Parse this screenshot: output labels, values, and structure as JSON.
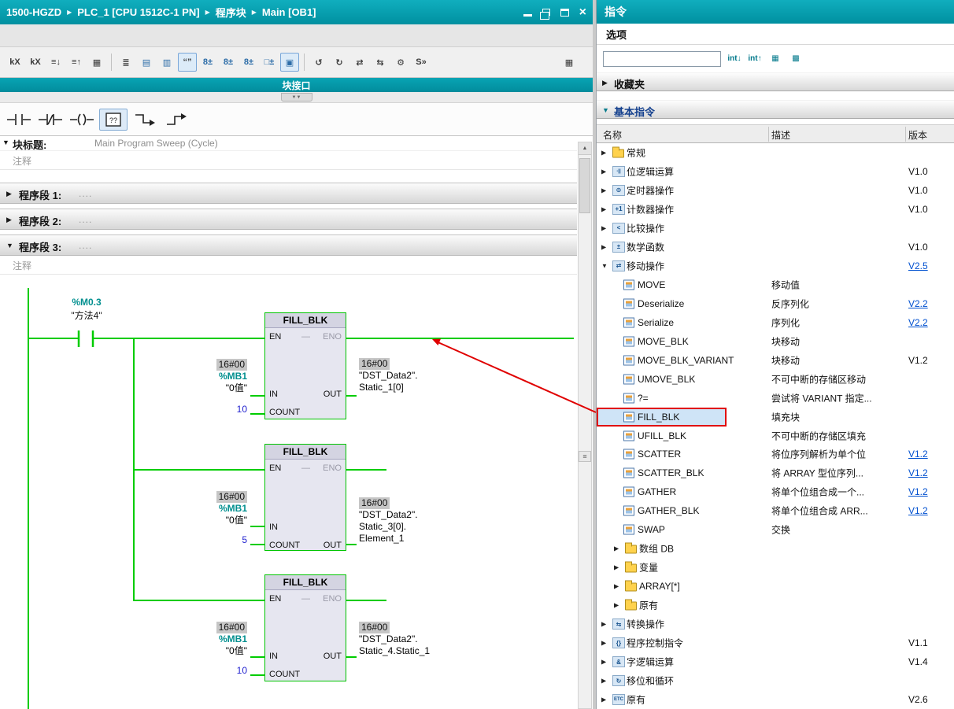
{
  "colors": {
    "titlebar_teal": "#0098a6",
    "wire_green": "#00cc00",
    "operand_teal": "#008f8f",
    "number_blue": "#2323cf",
    "link_blue": "#0050d0",
    "annotation_red": "#e00000",
    "selected_row_blue": "#cfe4f7",
    "monitor_value_bg": "#c6c6c6"
  },
  "titlebar": {
    "breadcrumb": [
      "1500-HGZD",
      "PLC_1 [CPU 1512C-1 PN]",
      "程序块",
      "Main [OB1]"
    ],
    "controls": [
      "minimize",
      "float",
      "maximize",
      "close"
    ]
  },
  "toolbar": {
    "icons": [
      {
        "name": "absolute-operands-icon",
        "glyph": "kX"
      },
      {
        "name": "symbolic-operands-icon",
        "glyph": "kX"
      },
      {
        "name": "network-expand-all-icon",
        "glyph": "≡↓"
      },
      {
        "name": "network-collapse-all-icon",
        "glyph": "≡↑"
      },
      {
        "name": "insert-network-icon",
        "glyph": "▦"
      },
      {
        "sep": true
      },
      {
        "name": "network-overview-icon",
        "glyph": "≣"
      },
      {
        "name": "maximize-editor-icon",
        "glyph": "▤",
        "blue": true
      },
      {
        "name": "split-editor-icon",
        "glyph": "▥",
        "blue": true
      },
      {
        "name": "toggle-comments-icon",
        "glyph": "“”",
        "active": true
      },
      {
        "name": "operand-absolute-info-icon",
        "glyph": "8±",
        "blue": true
      },
      {
        "name": "operand-symbolic-info-icon",
        "glyph": "8±",
        "blue": true
      },
      {
        "name": "operand-both-info-icon",
        "glyph": "8±",
        "blue": true
      },
      {
        "name": "box-parameters-icon",
        "glyph": "□±",
        "blue": true
      },
      {
        "name": "highlight-operand-icon",
        "glyph": "▣",
        "active": true,
        "blue": true
      },
      {
        "sep": true
      },
      {
        "name": "goto-previous-error-icon",
        "glyph": "↺"
      },
      {
        "name": "goto-next-error-icon",
        "glyph": "↻"
      },
      {
        "name": "update-block-calls-icon",
        "glyph": "⇄"
      },
      {
        "name": "consistency-check-icon",
        "glyph": "⇆"
      },
      {
        "name": "settings-icon",
        "glyph": "⚙"
      },
      {
        "name": "snapshot-icon",
        "glyph": "S»"
      },
      {
        "name": "editor-layout-icon",
        "glyph": "▦",
        "pushright": true
      }
    ]
  },
  "block_interface_label": "块接口",
  "editor": {
    "block_title_label": "块标题:",
    "block_title_text": "Main Program Sweep (Cycle)",
    "comment_text": "注释",
    "network_dots": "....",
    "networks": [
      {
        "label": "程序段 1:",
        "expanded": false
      },
      {
        "label": "程序段 2:",
        "expanded": false
      },
      {
        "label": "程序段 3:",
        "expanded": true
      }
    ],
    "ladder": {
      "contact": {
        "operand": "%M0.3",
        "name": "\"方法4\""
      },
      "pins": {
        "en": "EN",
        "eno": "ENO",
        "in": "IN",
        "count": "COUNT",
        "out": "OUT"
      },
      "blocks": [
        {
          "title": "FILL_BLK",
          "in_monitor": "16#00",
          "in_operand": "%MB1",
          "in_name": "\"0值\"",
          "count": "10",
          "out_monitor": "16#00",
          "out_lines": [
            "\"DST_Data2\".",
            "Static_1[0]"
          ]
        },
        {
          "title": "FILL_BLK",
          "in_monitor": "16#00",
          "in_operand": "%MB1",
          "in_name": "\"0值\"",
          "count": "5",
          "out_monitor": "16#00",
          "out_lines": [
            "\"DST_Data2\".",
            "Static_3[0].",
            "Element_1"
          ]
        },
        {
          "title": "FILL_BLK",
          "in_monitor": "16#00",
          "in_operand": "%MB1",
          "in_name": "\"0值\"",
          "count": "10",
          "out_monitor": "16#00",
          "out_lines": [
            "\"DST_Data2\".",
            "Static_4.Static_1"
          ]
        }
      ]
    }
  },
  "instructions_panel": {
    "title": "指令",
    "options_label": "选项",
    "search_value": "",
    "search_icons": [
      {
        "name": "filter-profile-icon",
        "glyph": "int↓"
      },
      {
        "name": "filter-all-icon",
        "glyph": "int↑"
      },
      {
        "name": "view-mode-icon",
        "glyph": "▦"
      },
      {
        "name": "pin-palette-icon",
        "glyph": "▩"
      }
    ],
    "favorites_label": "收藏夹",
    "basic_label": "基本指令",
    "columns": [
      "名称",
      "描述",
      "版本"
    ],
    "rows": [
      {
        "t": "cat",
        "icon": "folder",
        "name": "常规",
        "desc": "",
        "ver": ""
      },
      {
        "t": "cat",
        "icon": "bitlogic",
        "name": "位逻辑运算",
        "desc": "",
        "ver": "V1.0"
      },
      {
        "t": "cat",
        "icon": "timer",
        "name": "定时器操作",
        "desc": "",
        "ver": "V1.0"
      },
      {
        "t": "cat",
        "icon": "counter",
        "name": "计数器操作",
        "desc": "",
        "ver": "V1.0"
      },
      {
        "t": "cat",
        "icon": "compare",
        "name": "比较操作",
        "desc": "",
        "ver": ""
      },
      {
        "t": "cat",
        "icon": "math",
        "name": "数学函数",
        "desc": "",
        "ver": "V1.0"
      },
      {
        "t": "cat",
        "icon": "move",
        "name": "移动操作",
        "desc": "",
        "ver": "V2.5",
        "link": true,
        "exp": true
      },
      {
        "t": "ins",
        "icon": "instr",
        "name": "MOVE",
        "desc": "移动值",
        "ver": ""
      },
      {
        "t": "ins",
        "icon": "instr",
        "name": "Deserialize",
        "desc": "反序列化",
        "ver": "V2.2",
        "link": true
      },
      {
        "t": "ins",
        "icon": "instr",
        "name": "Serialize",
        "desc": "序列化",
        "ver": "V2.2",
        "link": true
      },
      {
        "t": "ins",
        "icon": "instr",
        "name": "MOVE_BLK",
        "desc": "块移动",
        "ver": ""
      },
      {
        "t": "ins",
        "icon": "instr",
        "name": "MOVE_BLK_VARIANT",
        "desc": "块移动",
        "ver": "V1.2"
      },
      {
        "t": "ins",
        "icon": "instr",
        "name": "UMOVE_BLK",
        "desc": "不可中断的存储区移动",
        "ver": ""
      },
      {
        "t": "ins",
        "icon": "instr",
        "name": "?=",
        "desc": "尝试将 VARIANT 指定...",
        "ver": ""
      },
      {
        "t": "ins",
        "icon": "instr",
        "name": "FILL_BLK",
        "desc": "填充块",
        "ver": "",
        "sel": true,
        "red": true
      },
      {
        "t": "ins",
        "icon": "instr",
        "name": "UFILL_BLK",
        "desc": "不可中断的存储区填充",
        "ver": ""
      },
      {
        "t": "ins",
        "icon": "instr",
        "name": "SCATTER",
        "desc": "将位序列解析为单个位",
        "ver": "V1.2",
        "link": true
      },
      {
        "t": "ins",
        "icon": "instr",
        "name": "SCATTER_BLK",
        "desc": "将 ARRAY 型位序列...",
        "ver": "V1.2",
        "link": true
      },
      {
        "t": "ins",
        "icon": "instr",
        "name": "GATHER",
        "desc": "将单个位组合成一个...",
        "ver": "V1.2",
        "link": true
      },
      {
        "t": "ins",
        "icon": "instr",
        "name": "GATHER_BLK",
        "desc": "将单个位组合成 ARR...",
        "ver": "V1.2",
        "link": true
      },
      {
        "t": "ins",
        "icon": "instr",
        "name": "SWAP",
        "desc": "交换",
        "ver": ""
      },
      {
        "t": "sub",
        "icon": "folder",
        "name": "数组 DB",
        "desc": "",
        "ver": ""
      },
      {
        "t": "sub",
        "icon": "folder",
        "name": "变量",
        "desc": "",
        "ver": ""
      },
      {
        "t": "sub",
        "icon": "folder",
        "name": "ARRAY[*]",
        "desc": "",
        "ver": ""
      },
      {
        "t": "sub",
        "icon": "folder",
        "name": "原有",
        "desc": "",
        "ver": ""
      },
      {
        "t": "cat",
        "icon": "convert",
        "name": "转换操作",
        "desc": "",
        "ver": ""
      },
      {
        "t": "cat",
        "icon": "progctl",
        "name": "程序控制指令",
        "desc": "",
        "ver": "V1.1"
      },
      {
        "t": "cat",
        "icon": "wordlogic",
        "name": "字逻辑运算",
        "desc": "",
        "ver": "V1.4"
      },
      {
        "t": "cat",
        "icon": "shift",
        "name": "移位和循环",
        "desc": "",
        "ver": ""
      },
      {
        "t": "cat",
        "icon": "legacy",
        "name": "原有",
        "desc": "",
        "ver": "V2.6"
      }
    ]
  }
}
